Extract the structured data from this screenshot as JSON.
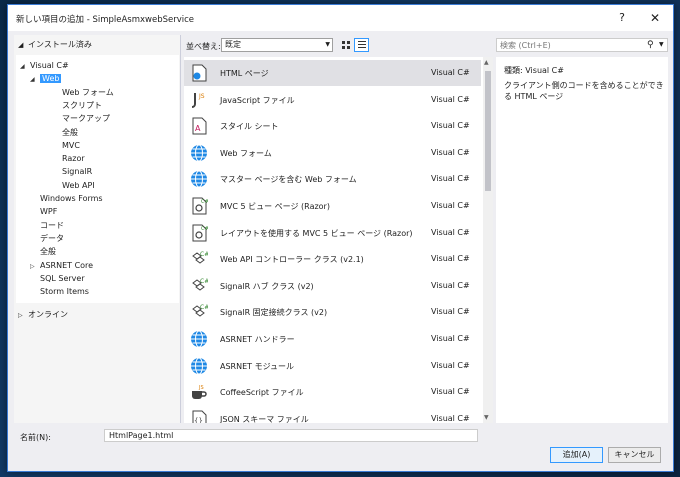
{
  "window": {
    "title": "新しい項目の追加 - SimpleAsmxwebService",
    "help_label": "?",
    "close_label": "✕"
  },
  "tree": {
    "header": "インストール済み",
    "items": [
      {
        "label": "Visual C#",
        "level": 0,
        "expanded": true,
        "selected": false
      },
      {
        "label": "Web",
        "level": 1,
        "expanded": true,
        "selected": true
      },
      {
        "label": "Web フォーム",
        "level": 2,
        "expanded": false,
        "selected": false
      },
      {
        "label": "スクリプト",
        "level": 2,
        "expanded": false,
        "selected": false
      },
      {
        "label": "マークアップ",
        "level": 2,
        "expanded": false,
        "selected": false
      },
      {
        "label": "全般",
        "level": 2,
        "expanded": false,
        "selected": false
      },
      {
        "label": "MVC",
        "level": 2,
        "expanded": false,
        "selected": false
      },
      {
        "label": "Razor",
        "level": 2,
        "expanded": false,
        "selected": false
      },
      {
        "label": "SignalR",
        "level": 2,
        "expanded": false,
        "selected": false
      },
      {
        "label": "Web API",
        "level": 2,
        "expanded": false,
        "selected": false
      },
      {
        "label": "Windows Forms",
        "level": 1,
        "expanded": false,
        "selected": false
      },
      {
        "label": "WPF",
        "level": 1,
        "expanded": false,
        "selected": false
      },
      {
        "label": "コード",
        "level": 1,
        "expanded": false,
        "selected": false
      },
      {
        "label": "データ",
        "level": 1,
        "expanded": false,
        "selected": false
      },
      {
        "label": "全般",
        "level": 1,
        "expanded": false,
        "selected": false
      },
      {
        "label": "ASRNET Core",
        "level": 1,
        "expanded": false,
        "selected": false
      },
      {
        "label": "SQL Server",
        "level": 1,
        "expanded": false,
        "selected": false
      },
      {
        "label": "Storm Items",
        "level": 1,
        "expanded": false,
        "selected": false
      }
    ],
    "online": "オンライン"
  },
  "toolbar": {
    "sort_label": "並べ替え:",
    "sort_value": "既定"
  },
  "templates": [
    {
      "name": "HTML ページ",
      "lang": "Visual C#",
      "icon": "html-page-icon",
      "selected": true
    },
    {
      "name": "JavaScript ファイル",
      "lang": "Visual C#",
      "icon": "javascript-file-icon",
      "selected": false
    },
    {
      "name": "スタイル シート",
      "lang": "Visual C#",
      "icon": "stylesheet-icon",
      "selected": false
    },
    {
      "name": "Web フォーム",
      "lang": "Visual C#",
      "icon": "globe-icon",
      "selected": false
    },
    {
      "name": "マスター ページを含む Web フォーム",
      "lang": "Visual C#",
      "icon": "globe-icon",
      "selected": false
    },
    {
      "name": "MVC 5 ビュー ページ (Razor)",
      "lang": "Visual C#",
      "icon": "razor-page-icon",
      "selected": false
    },
    {
      "name": "レイアウトを使用する MVC 5 ビュー ページ (Razor)",
      "lang": "Visual C#",
      "icon": "razor-page-icon",
      "selected": false
    },
    {
      "name": "Web API コントローラー クラス (v2.1)",
      "lang": "Visual C#",
      "icon": "csharp-class-icon",
      "selected": false
    },
    {
      "name": "SignalR ハブ クラス (v2)",
      "lang": "Visual C#",
      "icon": "csharp-class-icon",
      "selected": false
    },
    {
      "name": "SignalR 固定接続クラス (v2)",
      "lang": "Visual C#",
      "icon": "csharp-class-icon",
      "selected": false
    },
    {
      "name": "ASRNET ハンドラー",
      "lang": "Visual C#",
      "icon": "globe-icon",
      "selected": false
    },
    {
      "name": "ASRNET モジュール",
      "lang": "Visual C#",
      "icon": "globe-icon",
      "selected": false
    },
    {
      "name": "CoffeeScript ファイル",
      "lang": "Visual C#",
      "icon": "coffee-icon",
      "selected": false
    },
    {
      "name": "JSON スキーマ ファイル",
      "lang": "Visual C#",
      "icon": "json-file-icon",
      "selected": false
    }
  ],
  "search": {
    "placeholder": "検索 (Ctrl+E)"
  },
  "details": {
    "type_label": "種類:",
    "type_value": "Visual C#",
    "description": "クライアント側のコードを含めることができる HTML ページ"
  },
  "bottom": {
    "name_label": "名前(N):",
    "name_value": "HtmlPage1.html",
    "add_label": "追加(A)",
    "cancel_label": "キャンセル"
  },
  "colors": {
    "accent": "#3399ff",
    "dialog_bg": "#eeeef2",
    "selected_row": "#e0e0e4",
    "csharp_green": "#388a34",
    "globe_blue": "#1e88e5"
  }
}
